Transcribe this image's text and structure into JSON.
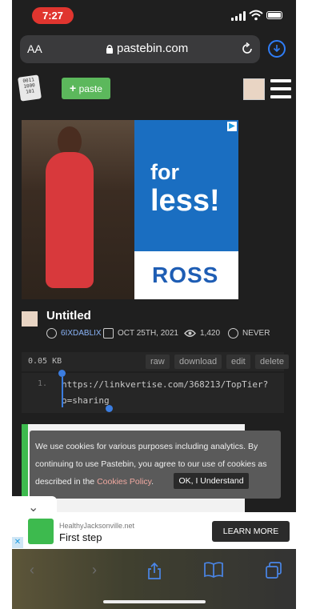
{
  "status_bar": {
    "time": "7:27"
  },
  "browser": {
    "text_size_label": "AA",
    "url": "pastebin.com"
  },
  "header": {
    "paste_button_label": "paste",
    "logo_text": "0011\n1000\n101"
  },
  "ad_top": {
    "line1": "for",
    "line2": "less!",
    "brand": "ROSS"
  },
  "paste": {
    "title": "Untitled",
    "author": "6IXDABLIX",
    "date": "OCT 25TH, 2021",
    "views": "1,420",
    "expires": "NEVER",
    "size": "0.05 KB",
    "actions": [
      "raw",
      "download",
      "edit",
      "delete"
    ],
    "line_number": "1.",
    "code_line1": "https://linkvertise.com/368213/TopTier?",
    "code_line2": "o=sharing"
  },
  "cookie": {
    "text": "We use cookies for various purposes including analytics. By continuing to use Pastebin, you agree to our use of cookies as described in the",
    "link": "Cookies Policy",
    "button": "OK, I Understand"
  },
  "banner": {
    "source": "HealthyJacksonville.net",
    "headline": "First step",
    "button": "LEARN MORE"
  },
  "colors": {
    "accent": "#5cb85c",
    "ios_blue": "#2f7df6",
    "status_red": "#e0352f"
  }
}
